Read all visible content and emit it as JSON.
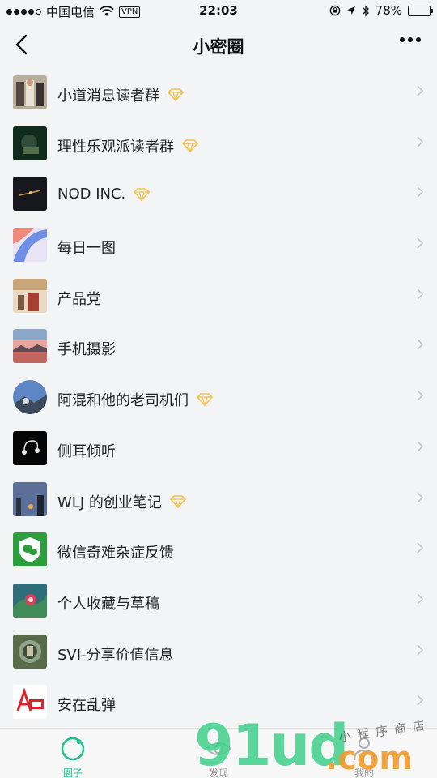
{
  "status": {
    "carrier": "中国电信",
    "vpn": "VPN",
    "time": "22:03",
    "battery": "78%",
    "battery_level": 0.78
  },
  "header": {
    "title": "小密圈"
  },
  "groups": [
    {
      "name": "小道消息读者群",
      "premium": true
    },
    {
      "name": "理性乐观派读者群",
      "premium": true
    },
    {
      "name": "NOD INC.",
      "premium": true
    },
    {
      "name": "每日一图",
      "premium": false
    },
    {
      "name": "产品党",
      "premium": false
    },
    {
      "name": "手机摄影",
      "premium": false
    },
    {
      "name": "阿混和他的老司机们",
      "premium": true
    },
    {
      "name": "侧耳倾听",
      "premium": false
    },
    {
      "name": "WLJ 的创业笔记",
      "premium": true
    },
    {
      "name": "微信奇难杂症反馈",
      "premium": false
    },
    {
      "name": "个人收藏与草稿",
      "premium": false
    },
    {
      "name": "SVI-分享价值信息",
      "premium": false
    },
    {
      "name": "安在乱弹",
      "premium": false
    }
  ],
  "tabs": [
    {
      "label": "圈子",
      "active": true
    },
    {
      "label": "发现",
      "active": false
    },
    {
      "label": "我的",
      "active": false
    }
  ],
  "watermark": {
    "main": "91ud",
    "suffix": ".com",
    "script": "小程序商店"
  },
  "colors": {
    "accent": "#1fbf90",
    "diamond": "#f2c14e",
    "watermark_green": "#3fd18a",
    "watermark_orange": "#f29a2e"
  }
}
